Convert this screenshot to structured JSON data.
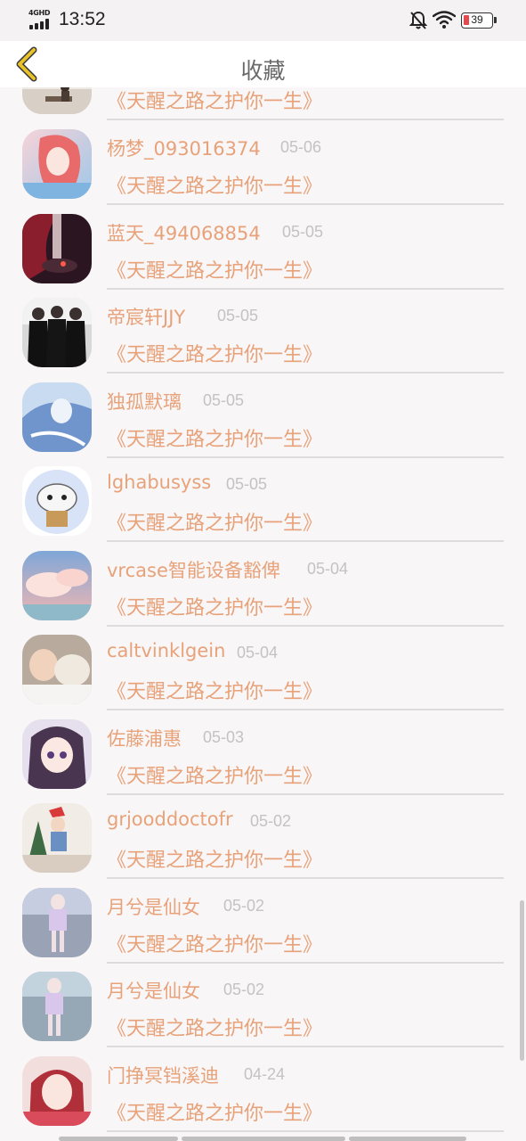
{
  "status_bar": {
    "network": "4GHD",
    "time": "13:52",
    "battery": "39"
  },
  "header": {
    "title": "收藏"
  },
  "favorites": [
    {
      "name": "",
      "date": "",
      "title": "《天醒之路之护你一生》",
      "avatar": "person-at-desk"
    },
    {
      "name": "杨梦_093016374",
      "date": "05-06",
      "title": "《天醒之路之护你一生》",
      "avatar": "anime-pink-hair"
    },
    {
      "name": "蓝天_494068854",
      "date": "05-05",
      "title": "《天醒之路之护你一生》",
      "avatar": "dark-red-art"
    },
    {
      "name": "帝宸轩JJY",
      "date": "05-05",
      "title": "《天醒之路之护你一生》",
      "avatar": "group-photo"
    },
    {
      "name": "独孤默璃",
      "date": "05-05",
      "title": "《天醒之路之护你一生》",
      "avatar": "anime-blue"
    },
    {
      "name": "lghabusyss",
      "date": "05-05",
      "title": "《天醒之路之护你一生》",
      "avatar": "cartoon-cat"
    },
    {
      "name": "vrcase智能设备豁俾",
      "date": "05-04",
      "title": "《天醒之路之护你一生》",
      "avatar": "sky-clouds"
    },
    {
      "name": "caltvinklgein",
      "date": "05-04",
      "title": "《天醒之路之护你一生》",
      "avatar": "baby-with-dog"
    },
    {
      "name": "佐藤浦惠",
      "date": "05-03",
      "title": "《天醒之路之护你一生》",
      "avatar": "anime-girl"
    },
    {
      "name": "grjooddoctofr",
      "date": "05-02",
      "title": "《天醒之路之护你一生》",
      "avatar": "christmas-child"
    },
    {
      "name": "月兮是仙女",
      "date": "05-02",
      "title": "《天醒之路之护你一生》",
      "avatar": "game-character"
    },
    {
      "name": "月兮是仙女",
      "date": "05-02",
      "title": "《天醒之路之护你一生》",
      "avatar": "game-character"
    },
    {
      "name": "门挣冥铛溪迪",
      "date": "04-24",
      "title": "《天醒之路之护你一生》",
      "avatar": "girl-portrait"
    }
  ],
  "colors": {
    "accent": "#e8a27a",
    "date": "#c3c3c3",
    "back_arrow": "#e8c22a",
    "background": "#f8f6f7"
  }
}
